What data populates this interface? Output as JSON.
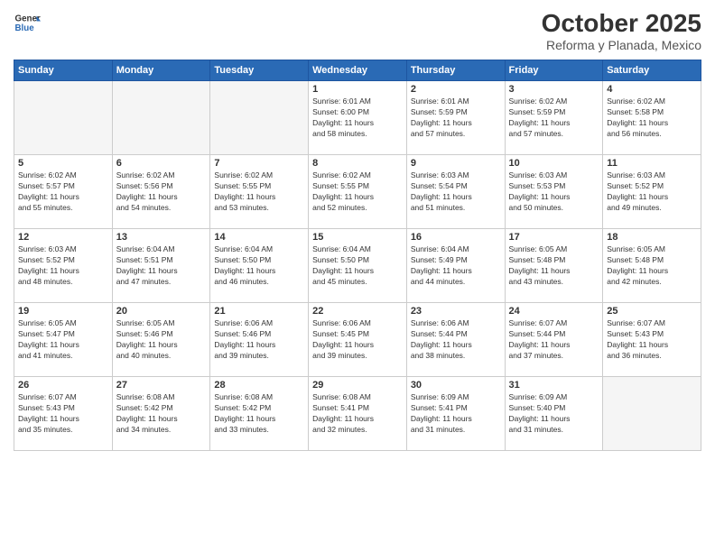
{
  "header": {
    "logo_general": "General",
    "logo_blue": "Blue",
    "month_title": "October 2025",
    "location": "Reforma y Planada, Mexico"
  },
  "days_of_week": [
    "Sunday",
    "Monday",
    "Tuesday",
    "Wednesday",
    "Thursday",
    "Friday",
    "Saturday"
  ],
  "weeks": [
    [
      {
        "day": "",
        "info": ""
      },
      {
        "day": "",
        "info": ""
      },
      {
        "day": "",
        "info": ""
      },
      {
        "day": "1",
        "info": "Sunrise: 6:01 AM\nSunset: 6:00 PM\nDaylight: 11 hours\nand 58 minutes."
      },
      {
        "day": "2",
        "info": "Sunrise: 6:01 AM\nSunset: 5:59 PM\nDaylight: 11 hours\nand 57 minutes."
      },
      {
        "day": "3",
        "info": "Sunrise: 6:02 AM\nSunset: 5:59 PM\nDaylight: 11 hours\nand 57 minutes."
      },
      {
        "day": "4",
        "info": "Sunrise: 6:02 AM\nSunset: 5:58 PM\nDaylight: 11 hours\nand 56 minutes."
      }
    ],
    [
      {
        "day": "5",
        "info": "Sunrise: 6:02 AM\nSunset: 5:57 PM\nDaylight: 11 hours\nand 55 minutes."
      },
      {
        "day": "6",
        "info": "Sunrise: 6:02 AM\nSunset: 5:56 PM\nDaylight: 11 hours\nand 54 minutes."
      },
      {
        "day": "7",
        "info": "Sunrise: 6:02 AM\nSunset: 5:55 PM\nDaylight: 11 hours\nand 53 minutes."
      },
      {
        "day": "8",
        "info": "Sunrise: 6:02 AM\nSunset: 5:55 PM\nDaylight: 11 hours\nand 52 minutes."
      },
      {
        "day": "9",
        "info": "Sunrise: 6:03 AM\nSunset: 5:54 PM\nDaylight: 11 hours\nand 51 minutes."
      },
      {
        "day": "10",
        "info": "Sunrise: 6:03 AM\nSunset: 5:53 PM\nDaylight: 11 hours\nand 50 minutes."
      },
      {
        "day": "11",
        "info": "Sunrise: 6:03 AM\nSunset: 5:52 PM\nDaylight: 11 hours\nand 49 minutes."
      }
    ],
    [
      {
        "day": "12",
        "info": "Sunrise: 6:03 AM\nSunset: 5:52 PM\nDaylight: 11 hours\nand 48 minutes."
      },
      {
        "day": "13",
        "info": "Sunrise: 6:04 AM\nSunset: 5:51 PM\nDaylight: 11 hours\nand 47 minutes."
      },
      {
        "day": "14",
        "info": "Sunrise: 6:04 AM\nSunset: 5:50 PM\nDaylight: 11 hours\nand 46 minutes."
      },
      {
        "day": "15",
        "info": "Sunrise: 6:04 AM\nSunset: 5:50 PM\nDaylight: 11 hours\nand 45 minutes."
      },
      {
        "day": "16",
        "info": "Sunrise: 6:04 AM\nSunset: 5:49 PM\nDaylight: 11 hours\nand 44 minutes."
      },
      {
        "day": "17",
        "info": "Sunrise: 6:05 AM\nSunset: 5:48 PM\nDaylight: 11 hours\nand 43 minutes."
      },
      {
        "day": "18",
        "info": "Sunrise: 6:05 AM\nSunset: 5:48 PM\nDaylight: 11 hours\nand 42 minutes."
      }
    ],
    [
      {
        "day": "19",
        "info": "Sunrise: 6:05 AM\nSunset: 5:47 PM\nDaylight: 11 hours\nand 41 minutes."
      },
      {
        "day": "20",
        "info": "Sunrise: 6:05 AM\nSunset: 5:46 PM\nDaylight: 11 hours\nand 40 minutes."
      },
      {
        "day": "21",
        "info": "Sunrise: 6:06 AM\nSunset: 5:46 PM\nDaylight: 11 hours\nand 39 minutes."
      },
      {
        "day": "22",
        "info": "Sunrise: 6:06 AM\nSunset: 5:45 PM\nDaylight: 11 hours\nand 39 minutes."
      },
      {
        "day": "23",
        "info": "Sunrise: 6:06 AM\nSunset: 5:44 PM\nDaylight: 11 hours\nand 38 minutes."
      },
      {
        "day": "24",
        "info": "Sunrise: 6:07 AM\nSunset: 5:44 PM\nDaylight: 11 hours\nand 37 minutes."
      },
      {
        "day": "25",
        "info": "Sunrise: 6:07 AM\nSunset: 5:43 PM\nDaylight: 11 hours\nand 36 minutes."
      }
    ],
    [
      {
        "day": "26",
        "info": "Sunrise: 6:07 AM\nSunset: 5:43 PM\nDaylight: 11 hours\nand 35 minutes."
      },
      {
        "day": "27",
        "info": "Sunrise: 6:08 AM\nSunset: 5:42 PM\nDaylight: 11 hours\nand 34 minutes."
      },
      {
        "day": "28",
        "info": "Sunrise: 6:08 AM\nSunset: 5:42 PM\nDaylight: 11 hours\nand 33 minutes."
      },
      {
        "day": "29",
        "info": "Sunrise: 6:08 AM\nSunset: 5:41 PM\nDaylight: 11 hours\nand 32 minutes."
      },
      {
        "day": "30",
        "info": "Sunrise: 6:09 AM\nSunset: 5:41 PM\nDaylight: 11 hours\nand 31 minutes."
      },
      {
        "day": "31",
        "info": "Sunrise: 6:09 AM\nSunset: 5:40 PM\nDaylight: 11 hours\nand 31 minutes."
      },
      {
        "day": "",
        "info": ""
      }
    ]
  ]
}
